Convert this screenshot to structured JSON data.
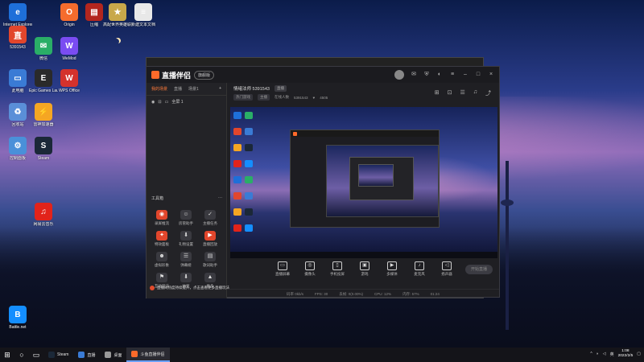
{
  "desktop": {
    "icons": [
      {
        "label": "Internet Explorer",
        "glyph": "e",
        "color": "#1e6fd9",
        "icon": "ie-icon"
      },
      {
        "label": "Origin",
        "glyph": "O",
        "color": "#f56c2d",
        "icon": "origin-icon"
      },
      {
        "label": "压缩",
        "glyph": "▤",
        "color": "#b3261e",
        "icon": "archive-icon"
      },
      {
        "label": "高配世界英雄联盟",
        "glyph": "★",
        "color": "#c8a84a",
        "icon": "game-icon"
      },
      {
        "label": "新建文本文档",
        "glyph": "≡",
        "color": "#e8e8e8",
        "icon": "text-file-icon"
      },
      {
        "label": "5391543",
        "glyph": "直",
        "color": "#e2462c",
        "icon": "stream-icon"
      },
      {
        "label": "微信",
        "glyph": "✉",
        "color": "#2aae67",
        "icon": "wechat-icon"
      },
      {
        "label": "WeMod",
        "glyph": "W",
        "color": "#7a4cf2",
        "icon": "wemod-icon"
      },
      {
        "label": "此电脑",
        "glyph": "▭",
        "color": "#3a7bd5",
        "icon": "computer-icon"
      },
      {
        "label": "Epic Games Launcher",
        "glyph": "E",
        "color": "#2a2a2a",
        "icon": "epic-icon"
      },
      {
        "label": "WPS Office",
        "glyph": "W",
        "color": "#d4322c",
        "icon": "wps-icon"
      },
      {
        "label": "回收站",
        "glyph": "♻",
        "color": "#5a8fd8",
        "icon": "recycle-bin-icon"
      },
      {
        "label": "控制面板",
        "glyph": "⚙",
        "color": "#4a90d9",
        "icon": "control-panel-icon"
      },
      {
        "label": "雷神加速器",
        "glyph": "⚡",
        "color": "#f5a623",
        "icon": "accelerator-icon"
      },
      {
        "label": "Steam",
        "glyph": "S",
        "color": "#1b2838",
        "icon": "steam-icon"
      },
      {
        "label": "网易云音乐",
        "glyph": "♫",
        "color": "#e2231a",
        "icon": "music-icon"
      },
      {
        "label": "Battle.net",
        "glyph": "B",
        "color": "#148eff",
        "icon": "battlenet-icon"
      }
    ]
  },
  "app": {
    "brand": "直播伴侣",
    "version_pill": "旗舰版",
    "tabs": [
      "我的场景",
      "直播",
      "场景1"
    ],
    "tab_add": "+",
    "scene_label": "全屏 1",
    "tools_heading": "工具箱",
    "tools_more": "···",
    "tools": [
      {
        "label": "录屏推流",
        "glyph": "◉",
        "hot": true
      },
      {
        "label": "房管助手",
        "glyph": "☺",
        "hot": false
      },
      {
        "label": "主播任务",
        "glyph": "✓",
        "hot": false
      },
      {
        "label": "特效面板",
        "glyph": "✦",
        "hot": true
      },
      {
        "label": "礼物设置",
        "glyph": "⬇",
        "hot": false
      },
      {
        "label": "直播回放",
        "glyph": "▶",
        "hot": true
      },
      {
        "label": "虚拟形象",
        "glyph": "☻",
        "hot": false
      },
      {
        "label": "弹幕姬",
        "glyph": "☰",
        "hot": false
      },
      {
        "label": "歌词助手",
        "glyph": "▤",
        "hot": false
      },
      {
        "label": "互动玩法",
        "glyph": "⚑",
        "hot": false
      },
      {
        "label": "抽奖",
        "glyph": "⬇",
        "hot": false
      },
      {
        "label": "更多",
        "glyph": "▲",
        "hot": false
      }
    ],
    "notice": "直播间热度持续提升，点击查看更多直播玩法",
    "room": {
      "name": "情绪法师 5391543",
      "tag": "直播",
      "category": "热门游戏",
      "sub": "主播",
      "online_label": "在线人数",
      "id": "5391543",
      "fans": "4505"
    },
    "controls": [
      {
        "label": "直播屏幕",
        "glyph": "▭"
      },
      {
        "label": "摄像头",
        "glyph": "◎"
      },
      {
        "label": "手机投屏",
        "glyph": "▯"
      },
      {
        "label": "游戏",
        "glyph": "▣"
      },
      {
        "label": "多媒体",
        "glyph": "▶"
      },
      {
        "label": "麦克风",
        "glyph": "♪"
      },
      {
        "label": "扬声器",
        "glyph": "◁"
      }
    ],
    "start_button": "开始直播",
    "status": [
      "码率 0kb/s",
      "FPS: 30",
      "丢帧: 0(0.00%)",
      "CPU: 12%",
      "内存: 57%",
      "01:24"
    ]
  },
  "taskbar": {
    "apps": [
      {
        "label": "Steam",
        "color": "#1b2838",
        "active": false
      },
      {
        "label": "直播",
        "color": "#3a7bd5",
        "active": false
      },
      {
        "label": "桌面",
        "color": "#999999",
        "active": false
      },
      {
        "label": "斗鱼直播伴侣",
        "color": "#ff6a2a",
        "active": true
      }
    ],
    "time": "1:08",
    "date": "2022/2/5",
    "ime": "英"
  }
}
